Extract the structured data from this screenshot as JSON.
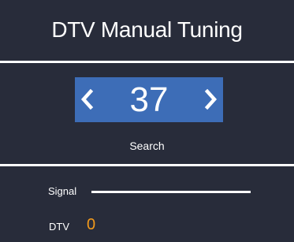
{
  "window": {
    "title": "DTV Manual Tuning"
  },
  "tuning": {
    "channel": "37",
    "left_icon": "chevron-left-icon",
    "right_icon": "chevron-right-icon",
    "action_label": "Search"
  },
  "status": {
    "signal_label": "Signal",
    "signal_level": 1.0,
    "dtv_label": "DTV",
    "dtv_value": "0"
  },
  "colors": {
    "panel_background": "#282c3a",
    "divider": "#ffffff",
    "selector_background": "#3d6db7",
    "text": "#ffffff",
    "accent": "#f39a1b"
  }
}
